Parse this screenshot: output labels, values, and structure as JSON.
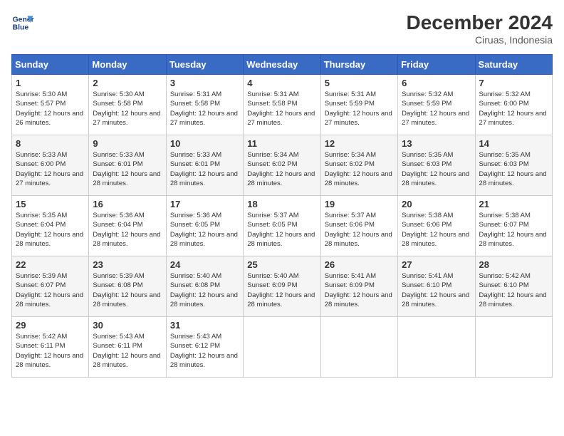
{
  "header": {
    "logo_line1": "General",
    "logo_line2": "Blue",
    "title": "December 2024",
    "subtitle": "Ciruas, Indonesia"
  },
  "weekdays": [
    "Sunday",
    "Monday",
    "Tuesday",
    "Wednesday",
    "Thursday",
    "Friday",
    "Saturday"
  ],
  "weeks": [
    [
      {
        "day": "1",
        "sunrise": "5:30 AM",
        "sunset": "5:57 PM",
        "daylight": "12 hours and 26 minutes."
      },
      {
        "day": "2",
        "sunrise": "5:30 AM",
        "sunset": "5:58 PM",
        "daylight": "12 hours and 27 minutes."
      },
      {
        "day": "3",
        "sunrise": "5:31 AM",
        "sunset": "5:58 PM",
        "daylight": "12 hours and 27 minutes."
      },
      {
        "day": "4",
        "sunrise": "5:31 AM",
        "sunset": "5:58 PM",
        "daylight": "12 hours and 27 minutes."
      },
      {
        "day": "5",
        "sunrise": "5:31 AM",
        "sunset": "5:59 PM",
        "daylight": "12 hours and 27 minutes."
      },
      {
        "day": "6",
        "sunrise": "5:32 AM",
        "sunset": "5:59 PM",
        "daylight": "12 hours and 27 minutes."
      },
      {
        "day": "7",
        "sunrise": "5:32 AM",
        "sunset": "6:00 PM",
        "daylight": "12 hours and 27 minutes."
      }
    ],
    [
      {
        "day": "8",
        "sunrise": "5:33 AM",
        "sunset": "6:00 PM",
        "daylight": "12 hours and 27 minutes."
      },
      {
        "day": "9",
        "sunrise": "5:33 AM",
        "sunset": "6:01 PM",
        "daylight": "12 hours and 28 minutes."
      },
      {
        "day": "10",
        "sunrise": "5:33 AM",
        "sunset": "6:01 PM",
        "daylight": "12 hours and 28 minutes."
      },
      {
        "day": "11",
        "sunrise": "5:34 AM",
        "sunset": "6:02 PM",
        "daylight": "12 hours and 28 minutes."
      },
      {
        "day": "12",
        "sunrise": "5:34 AM",
        "sunset": "6:02 PM",
        "daylight": "12 hours and 28 minutes."
      },
      {
        "day": "13",
        "sunrise": "5:35 AM",
        "sunset": "6:03 PM",
        "daylight": "12 hours and 28 minutes."
      },
      {
        "day": "14",
        "sunrise": "5:35 AM",
        "sunset": "6:03 PM",
        "daylight": "12 hours and 28 minutes."
      }
    ],
    [
      {
        "day": "15",
        "sunrise": "5:35 AM",
        "sunset": "6:04 PM",
        "daylight": "12 hours and 28 minutes."
      },
      {
        "day": "16",
        "sunrise": "5:36 AM",
        "sunset": "6:04 PM",
        "daylight": "12 hours and 28 minutes."
      },
      {
        "day": "17",
        "sunrise": "5:36 AM",
        "sunset": "6:05 PM",
        "daylight": "12 hours and 28 minutes."
      },
      {
        "day": "18",
        "sunrise": "5:37 AM",
        "sunset": "6:05 PM",
        "daylight": "12 hours and 28 minutes."
      },
      {
        "day": "19",
        "sunrise": "5:37 AM",
        "sunset": "6:06 PM",
        "daylight": "12 hours and 28 minutes."
      },
      {
        "day": "20",
        "sunrise": "5:38 AM",
        "sunset": "6:06 PM",
        "daylight": "12 hours and 28 minutes."
      },
      {
        "day": "21",
        "sunrise": "5:38 AM",
        "sunset": "6:07 PM",
        "daylight": "12 hours and 28 minutes."
      }
    ],
    [
      {
        "day": "22",
        "sunrise": "5:39 AM",
        "sunset": "6:07 PM",
        "daylight": "12 hours and 28 minutes."
      },
      {
        "day": "23",
        "sunrise": "5:39 AM",
        "sunset": "6:08 PM",
        "daylight": "12 hours and 28 minutes."
      },
      {
        "day": "24",
        "sunrise": "5:40 AM",
        "sunset": "6:08 PM",
        "daylight": "12 hours and 28 minutes."
      },
      {
        "day": "25",
        "sunrise": "5:40 AM",
        "sunset": "6:09 PM",
        "daylight": "12 hours and 28 minutes."
      },
      {
        "day": "26",
        "sunrise": "5:41 AM",
        "sunset": "6:09 PM",
        "daylight": "12 hours and 28 minutes."
      },
      {
        "day": "27",
        "sunrise": "5:41 AM",
        "sunset": "6:10 PM",
        "daylight": "12 hours and 28 minutes."
      },
      {
        "day": "28",
        "sunrise": "5:42 AM",
        "sunset": "6:10 PM",
        "daylight": "12 hours and 28 minutes."
      }
    ],
    [
      {
        "day": "29",
        "sunrise": "5:42 AM",
        "sunset": "6:11 PM",
        "daylight": "12 hours and 28 minutes."
      },
      {
        "day": "30",
        "sunrise": "5:43 AM",
        "sunset": "6:11 PM",
        "daylight": "12 hours and 28 minutes."
      },
      {
        "day": "31",
        "sunrise": "5:43 AM",
        "sunset": "6:12 PM",
        "daylight": "12 hours and 28 minutes."
      },
      null,
      null,
      null,
      null
    ]
  ],
  "labels": {
    "sunrise": "Sunrise:",
    "sunset": "Sunset:",
    "daylight": "Daylight:"
  }
}
